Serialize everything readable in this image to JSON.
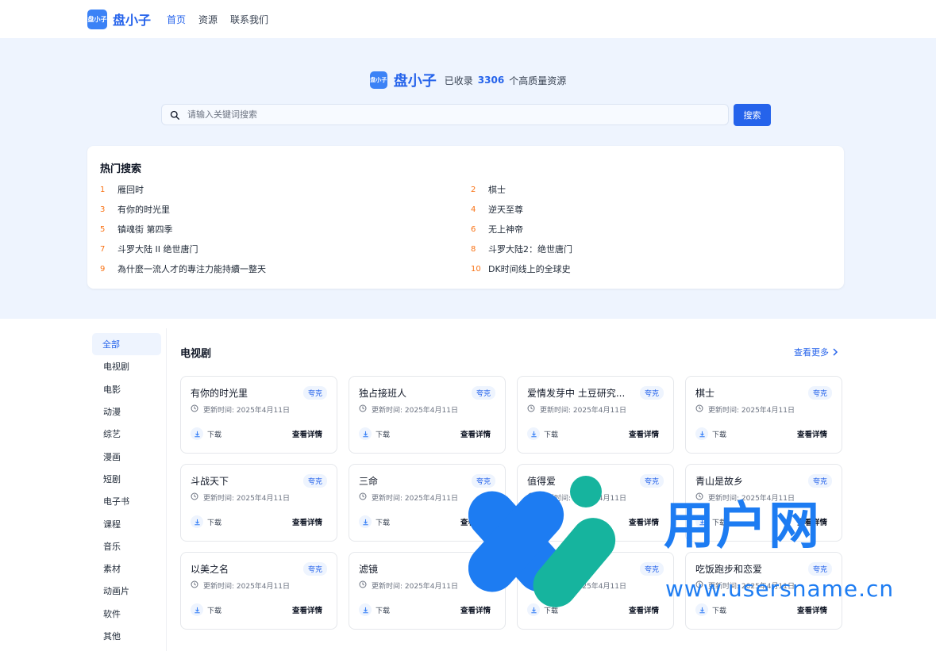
{
  "nav": {
    "logo_badge": "盘小子",
    "logo_text": "盘小子",
    "links": [
      "首页",
      "资源",
      "联系我们"
    ]
  },
  "hero": {
    "brand": "盘小子",
    "prefix": "已收录",
    "count": "3306",
    "suffix": "个高质量资源"
  },
  "search": {
    "placeholder": "请输入关键词搜索",
    "value": "",
    "button": "搜索"
  },
  "hot": {
    "title": "热门搜索",
    "items": [
      {
        "rank": "1",
        "text": "雁回时"
      },
      {
        "rank": "2",
        "text": "棋士"
      },
      {
        "rank": "3",
        "text": "有你的时光里"
      },
      {
        "rank": "4",
        "text": "逆天至尊"
      },
      {
        "rank": "5",
        "text": "镇魂街 第四季"
      },
      {
        "rank": "6",
        "text": "无上神帝"
      },
      {
        "rank": "7",
        "text": "斗罗大陆 II 绝世唐门"
      },
      {
        "rank": "8",
        "text": "斗罗大陆2：绝世唐门"
      },
      {
        "rank": "9",
        "text": "為什麼一流人才的專注力能持續一整天"
      },
      {
        "rank": "10",
        "text": "DK时间线上的全球史"
      }
    ]
  },
  "sidebar": {
    "items": [
      "全部",
      "电视剧",
      "电影",
      "动漫",
      "综艺",
      "漫画",
      "短剧",
      "电子书",
      "课程",
      "音乐",
      "素材",
      "动画片",
      "软件",
      "其他"
    ]
  },
  "section": {
    "title": "电视剧",
    "more": "查看更多"
  },
  "cards": [
    {
      "title": "有你的时光里",
      "tag": "夸克",
      "time": "更新时间: 2025年4月11日",
      "download": "下载",
      "detail": "查看详情"
    },
    {
      "title": "独占接班人",
      "tag": "夸克",
      "time": "更新时间: 2025年4月11日",
      "download": "下载",
      "detail": "查看详情"
    },
    {
      "title": "爱情发芽中 土豆研究...",
      "tag": "夸克",
      "time": "更新时间: 2025年4月11日",
      "download": "下载",
      "detail": "查看详情"
    },
    {
      "title": "棋士",
      "tag": "夸克",
      "time": "更新时间: 2025年4月11日",
      "download": "下载",
      "detail": "查看详情"
    },
    {
      "title": "斗战天下",
      "tag": "夸克",
      "time": "更新时间: 2025年4月11日",
      "download": "下载",
      "detail": "查看详情"
    },
    {
      "title": "三命",
      "tag": "夸克",
      "time": "更新时间: 2025年4月11日",
      "download": "下载",
      "detail": "查看详情"
    },
    {
      "title": "值得爱",
      "tag": "夸克",
      "time": "更新时间: 2025年4月11日",
      "download": "下载",
      "detail": "查看详情"
    },
    {
      "title": "青山是故乡",
      "tag": "夸克",
      "time": "更新时间: 2025年4月11日",
      "download": "下载",
      "detail": "查看详情"
    },
    {
      "title": "以美之名",
      "tag": "夸克",
      "time": "更新时间: 2025年4月11日",
      "download": "下载",
      "detail": "查看详情"
    },
    {
      "title": "滤镜",
      "tag": "夸克",
      "time": "更新时间: 2025年4月11日",
      "download": "下载",
      "detail": "查看详情"
    },
    {
      "title": "",
      "tag": "夸克",
      "time": "更新时间: 2025年4月11日",
      "download": "下载",
      "detail": "查看详情"
    },
    {
      "title": "吃饭跑步和恋爱",
      "tag": "夸克",
      "time": "更新时间: 2025年4月11日",
      "download": "下载",
      "detail": "查看详情"
    }
  ],
  "watermark": {
    "text": "用户网",
    "url": "www.usersname.cn"
  },
  "colors": {
    "accent": "#2563eb",
    "hero_bg": "#eef4fe",
    "rank": "#f97316"
  }
}
